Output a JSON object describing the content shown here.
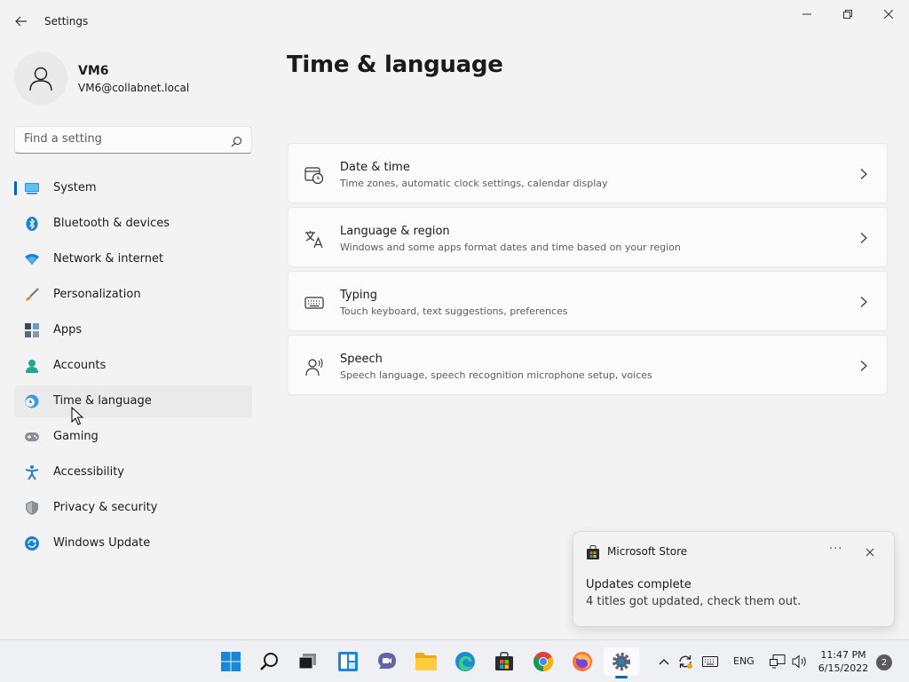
{
  "window": {
    "title": "Settings"
  },
  "profile": {
    "name": "VM6",
    "email": "VM6@collabnet.local"
  },
  "search": {
    "placeholder": "Find a setting"
  },
  "sidebar": {
    "items": [
      {
        "label": "System",
        "icon": "system-icon",
        "active": true
      },
      {
        "label": "Bluetooth & devices",
        "icon": "bluetooth-icon"
      },
      {
        "label": "Network & internet",
        "icon": "wifi-icon"
      },
      {
        "label": "Personalization",
        "icon": "brush-icon"
      },
      {
        "label": "Apps",
        "icon": "apps-icon"
      },
      {
        "label": "Accounts",
        "icon": "accounts-icon"
      },
      {
        "label": "Time & language",
        "icon": "time-language-icon",
        "hover": true
      },
      {
        "label": "Gaming",
        "icon": "gamepad-icon"
      },
      {
        "label": "Accessibility",
        "icon": "accessibility-icon"
      },
      {
        "label": "Privacy & security",
        "icon": "shield-icon"
      },
      {
        "label": "Windows Update",
        "icon": "update-icon"
      }
    ]
  },
  "main": {
    "title": "Time & language",
    "cards": [
      {
        "title": "Date & time",
        "subtitle": "Time zones, automatic clock settings, calendar display",
        "icon": "clock-calendar-icon"
      },
      {
        "title": "Language & region",
        "subtitle": "Windows and some apps format dates and time based on your region",
        "icon": "language-icon"
      },
      {
        "title": "Typing",
        "subtitle": "Touch keyboard, text suggestions, preferences",
        "icon": "keyboard-icon"
      },
      {
        "title": "Speech",
        "subtitle": "Speech language, speech recognition microphone setup, voices",
        "icon": "speech-icon"
      }
    ]
  },
  "toast": {
    "app": "Microsoft Store",
    "more": "···",
    "heading": "Updates complete",
    "body": "4 titles got updated, check them out."
  },
  "taskbar": {
    "language": "ENG",
    "time": "11:47 PM",
    "date": "6/15/2022",
    "notifications": "2"
  },
  "colors": {
    "accent": "#0067c0",
    "background": "#f3f3f3",
    "card": "#fbfbfb"
  }
}
